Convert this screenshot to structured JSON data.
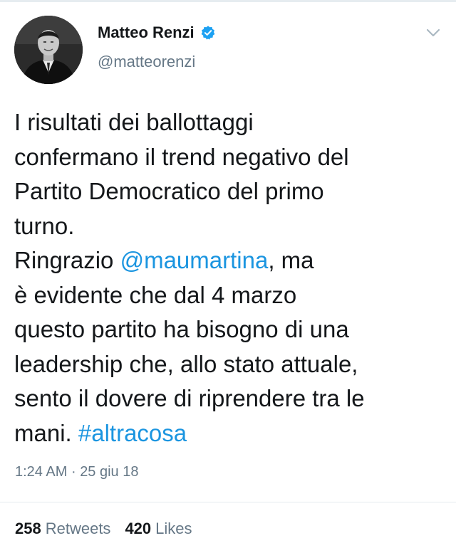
{
  "tweet": {
    "author": {
      "display_name": "Matteo Renzi",
      "handle": "@matteorenzi",
      "verified": true,
      "avatar_icon": "profile-photo"
    },
    "text_lines": [
      "I risultati dei ballottaggi",
      "confermano il trend negativo del",
      "Partito Democratico del primo",
      "turno.",
      "Ringrazio",
      "@maumartina",
      ", ma",
      "è evidente che dal 4 marzo",
      "questo partito ha bisogno di una",
      "leadership che, allo stato attuale,",
      "sento il dovere di riprendere tra le",
      "mani.",
      "#altracosa"
    ],
    "time": "1:24 AM",
    "separator": "·",
    "date": "25 giu 18",
    "retweets_count": "258",
    "retweets_label": "Retweets",
    "likes_count": "420",
    "likes_label": "Likes"
  },
  "colors": {
    "link": "#1b95e0",
    "verified": "#1da1f2",
    "secondary_text": "#657786",
    "primary_text": "#14171a"
  },
  "icons": {
    "verified": "verified-badge-icon",
    "menu": "chevron-down-icon"
  }
}
